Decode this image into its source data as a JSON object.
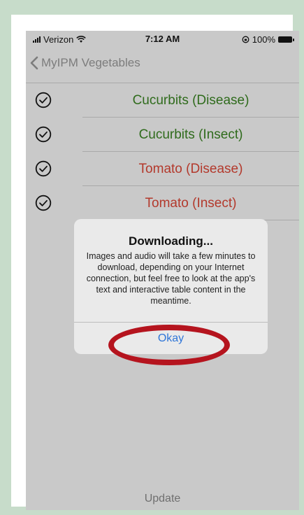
{
  "status_bar": {
    "carrier": "Verizon",
    "time": "7:12 AM",
    "battery": "100%"
  },
  "nav": {
    "back_label": "MyIPM Vegetables"
  },
  "list": {
    "items": [
      {
        "label": "Cucurbits (Disease)",
        "color": "#2f6b1c",
        "checked": true
      },
      {
        "label": "Cucurbits (Insect)",
        "color": "#2f6b1c",
        "checked": true
      },
      {
        "label": "Tomato (Disease)",
        "color": "#b3392c",
        "checked": true
      },
      {
        "label": "Tomato (Insect)",
        "color": "#b3392c",
        "checked": true
      }
    ]
  },
  "dialog": {
    "title": "Downloading...",
    "message": "Images and audio will take a few minutes to download, depending on your Internet connection, but feel free to look at the app's text and interactive table content in the meantime.",
    "button": "Okay",
    "annotation_color": "#b5141e"
  },
  "footer": {
    "update_label": "Update"
  }
}
